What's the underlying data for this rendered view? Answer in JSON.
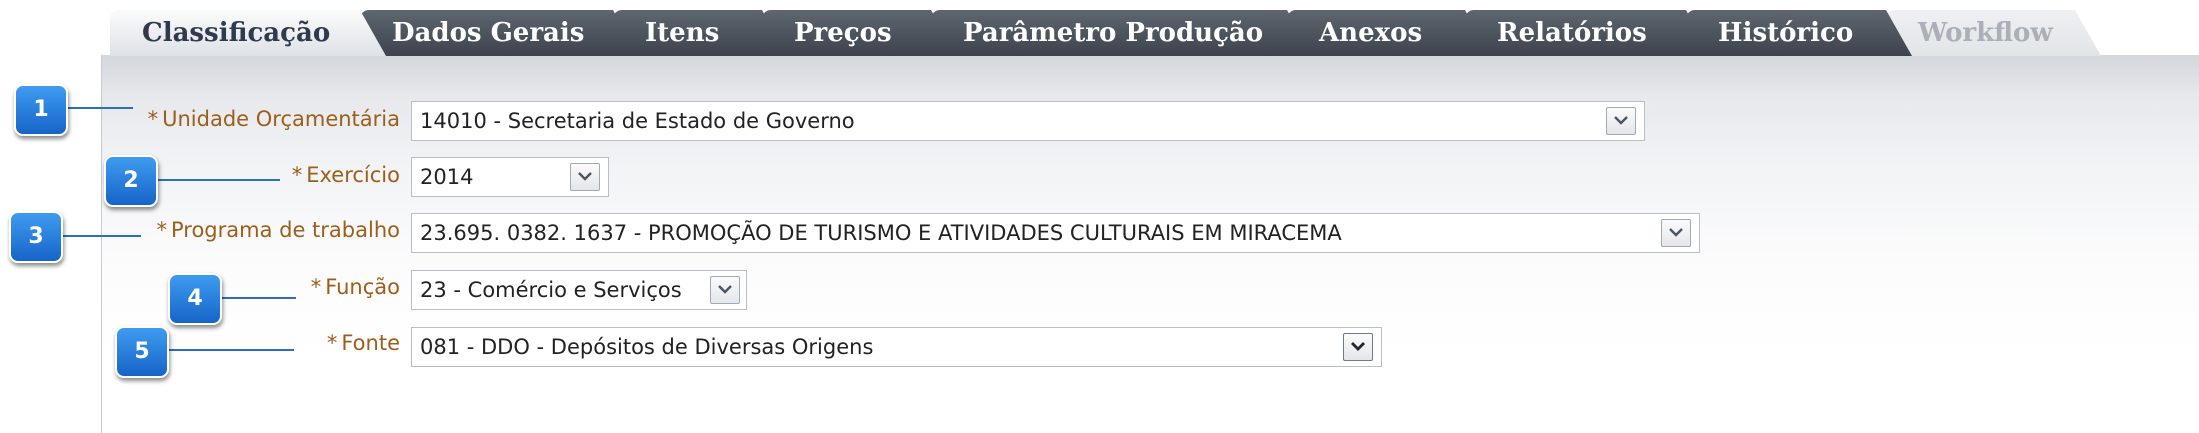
{
  "tabs": [
    {
      "label": "Classificação",
      "state": "active"
    },
    {
      "label": "Dados Gerais",
      "state": "normal"
    },
    {
      "label": "Itens",
      "state": "normal"
    },
    {
      "label": "Preços",
      "state": "normal"
    },
    {
      "label": "Parâmetro Produção",
      "state": "normal"
    },
    {
      "label": "Anexos",
      "state": "normal"
    },
    {
      "label": "Relatórios",
      "state": "normal"
    },
    {
      "label": "Histórico",
      "state": "normal"
    },
    {
      "label": "Workflow",
      "state": "disabled"
    }
  ],
  "form": {
    "required_marker": "*",
    "unidade": {
      "label": "Unidade Orçamentária",
      "value": "14010 - Secretaria de Estado de Governo"
    },
    "exercicio": {
      "label": "Exercício",
      "value": "2014"
    },
    "programa": {
      "label": "Programa de trabalho",
      "value": "23.695. 0382. 1637 - PROMOÇÃO DE TURISMO E ATIVIDADES CULTURAIS EM MIRACEMA"
    },
    "funcao": {
      "label": "Função",
      "value": "23 - Comércio e Serviços"
    },
    "fonte": {
      "label": "Fonte",
      "value": "081 - DDO - Depósitos de Diversas Origens"
    }
  },
  "callouts": [
    "1",
    "2",
    "3",
    "4",
    "5"
  ],
  "colors": {
    "label": "#9b5f1a",
    "callout": "#1f78dc",
    "tab_dark": "#4a525c",
    "tab_active_text": "#2f3a4f",
    "tab_disabled_text": "#a9b0b9"
  }
}
